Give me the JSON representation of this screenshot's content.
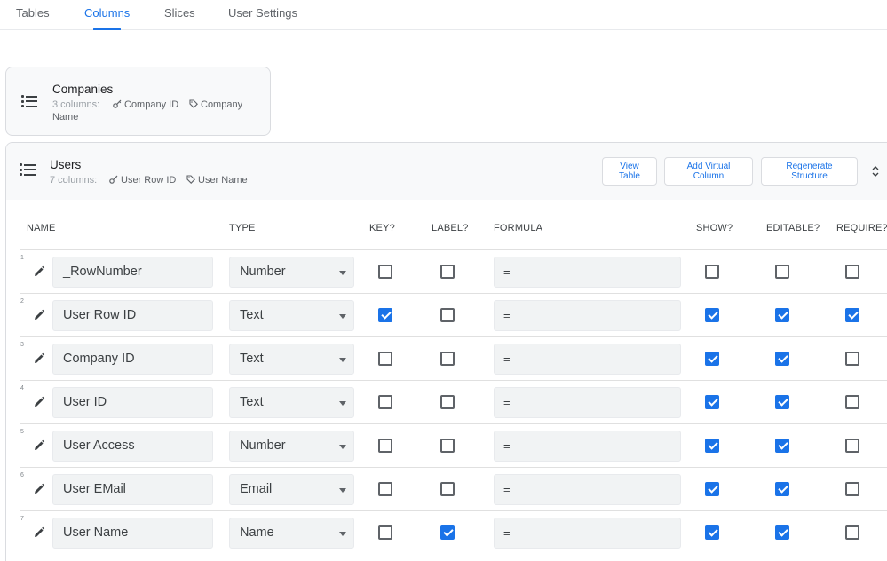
{
  "tabs": [
    {
      "label": "Tables",
      "active": false
    },
    {
      "label": "Columns",
      "active": true
    },
    {
      "label": "Slices",
      "active": false
    },
    {
      "label": "User Settings",
      "active": false
    }
  ],
  "companies": {
    "title": "Companies",
    "count_label": "3 columns:",
    "key_column": "Company ID",
    "label_column_line1": "Company",
    "label_column_line2": "Name"
  },
  "users": {
    "title": "Users",
    "count_label": "7 columns:",
    "key_column": "User Row ID",
    "label_column": "User Name",
    "buttons": {
      "view_table_1": "View",
      "view_table_2": "Table",
      "add_virtual_1": "Add Virtual",
      "add_virtual_2": "Column",
      "regenerate_1": "Regenerate",
      "regenerate_2": "Structure"
    }
  },
  "table": {
    "headers": {
      "name": "NAME",
      "type": "TYPE",
      "key": "KEY?",
      "label": "LABEL?",
      "formula": "FORMULA",
      "show": "SHOW?",
      "editable": "EDITABLE?",
      "require": "REQUIRE?"
    },
    "rows": [
      {
        "num": "1",
        "name": "_RowNumber",
        "type": "Number",
        "formula": "=",
        "key": false,
        "label": false,
        "show": false,
        "editable": false,
        "require": false
      },
      {
        "num": "2",
        "name": "User Row ID",
        "type": "Text",
        "formula": "=",
        "key": true,
        "label": false,
        "show": true,
        "editable": true,
        "require": true
      },
      {
        "num": "3",
        "name": "Company ID",
        "type": "Text",
        "formula": "=",
        "key": false,
        "label": false,
        "show": true,
        "editable": true,
        "require": false
      },
      {
        "num": "4",
        "name": "User ID",
        "type": "Text",
        "formula": "=",
        "key": false,
        "label": false,
        "show": true,
        "editable": true,
        "require": false
      },
      {
        "num": "5",
        "name": "User Access",
        "type": "Number",
        "formula": "=",
        "key": false,
        "label": false,
        "show": true,
        "editable": true,
        "require": false
      },
      {
        "num": "6",
        "name": "User EMail",
        "type": "Email",
        "formula": "=",
        "key": false,
        "label": false,
        "show": true,
        "editable": true,
        "require": false
      },
      {
        "num": "7",
        "name": "User Name",
        "type": "Name",
        "formula": "=",
        "key": false,
        "label": true,
        "show": true,
        "editable": true,
        "require": false
      }
    ]
  },
  "colors": {
    "accent": "#1a73e8"
  }
}
